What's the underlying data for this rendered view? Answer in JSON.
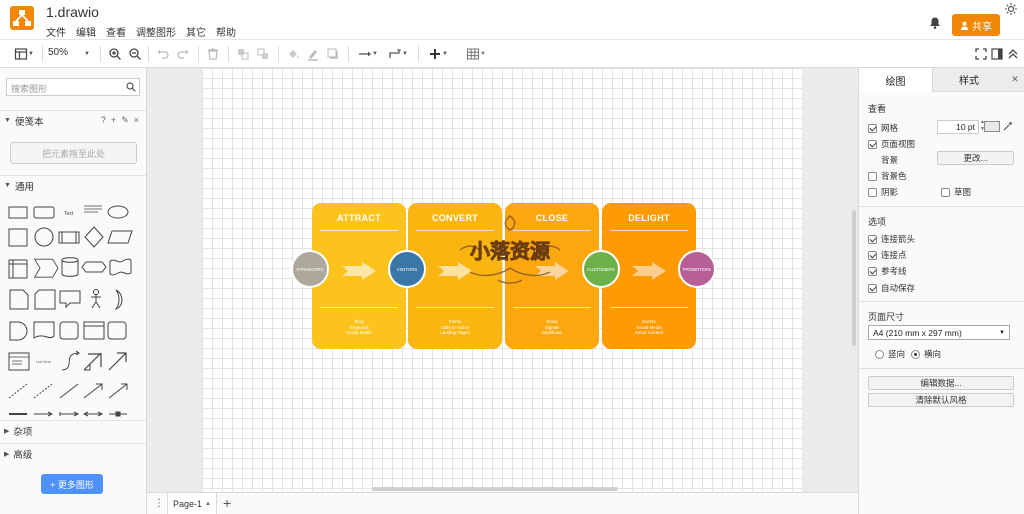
{
  "app": {
    "title": "1.drawio",
    "share_label": "共享"
  },
  "menu": [
    "文件",
    "编辑",
    "查看",
    "调整图形",
    "其它",
    "帮助"
  ],
  "toolbar": {
    "zoom": "50%"
  },
  "sidebar": {
    "search_placeholder": "搜索图形",
    "scratchpad_title": "便笺本",
    "scratchpad_tools": [
      "?",
      "+",
      "✎",
      "×"
    ],
    "drop_hint": "把元素拖至此处",
    "general_title": "通用",
    "misc_title": "杂项",
    "advanced_title": "高级",
    "more_shapes": "+ 更多图形"
  },
  "diagram": {
    "columns": [
      {
        "title": "ATTRACT",
        "lines": [
          "Blog",
          "Keywords",
          "Social Media"
        ],
        "color": "#fcc31c"
      },
      {
        "title": "CONVERT",
        "lines": [
          "Forms",
          "Calls-to-Action",
          "Landing Pages"
        ],
        "color": "#fbb511"
      },
      {
        "title": "CLOSE",
        "lines": [
          "Email",
          "Signals",
          "Workflows"
        ],
        "color": "#fca70e"
      },
      {
        "title": "DELIGHT",
        "lines": [
          "Events",
          "Social Media",
          "Smart Content"
        ],
        "color": "#fd9a04"
      }
    ],
    "stages": [
      {
        "label": "STRANGERS",
        "color": "#aea89b"
      },
      {
        "label": "VISITORS",
        "color": "#3a77a9"
      },
      {
        "label": "CUSTOMERS",
        "color": "#6cb04a"
      },
      {
        "label": "PROMOTERS",
        "color": "#b75f97"
      }
    ]
  },
  "watermark": {
    "text": "小落资源"
  },
  "bottom": {
    "page_tab": "Page-1"
  },
  "format": {
    "tabs": [
      "绘图",
      "样式"
    ],
    "view_title": "查看",
    "grid_label": "网格",
    "grid_size": "10 pt",
    "page_view_label": "页面视图",
    "background_label": "背景",
    "change_label": "更改...",
    "bg_color_label": "背景色",
    "shadow_label": "阴影",
    "sketch_label": "草图",
    "options_title": "选项",
    "options": [
      "连接箭头",
      "连接点",
      "参考线",
      "自动保存"
    ],
    "page_size_title": "页面尺寸",
    "page_size_value": "A4 (210 mm x 297 mm)",
    "portrait_label": "竖向",
    "landscape_label": "横向",
    "edit_data": "编辑数据...",
    "clear_style": "清除默认风格"
  },
  "colors": {
    "brand": "#f08705",
    "primary": "#4d90fe"
  }
}
